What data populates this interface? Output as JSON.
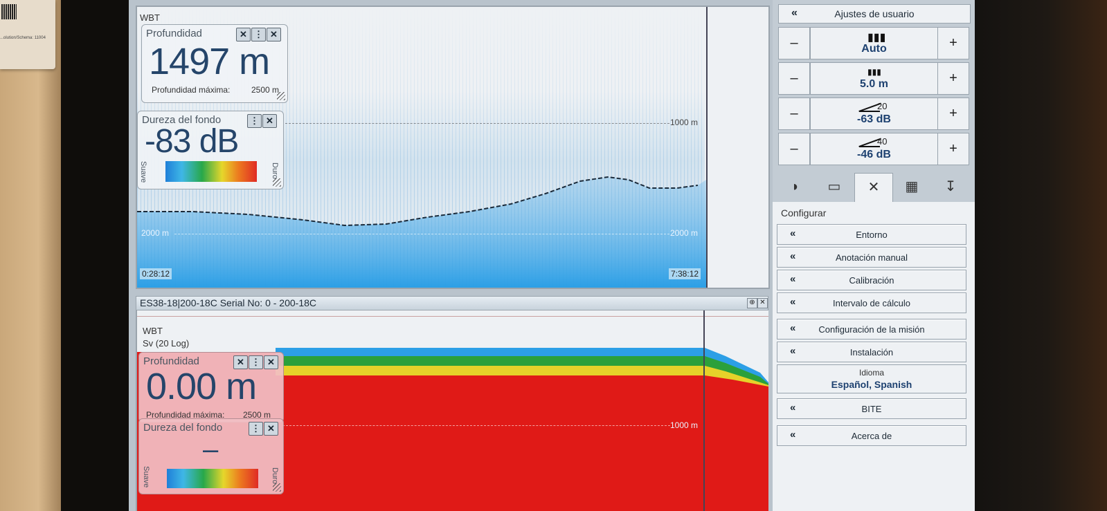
{
  "sticker": {
    "text": "...olution/Schema: 11004"
  },
  "top_echogram": {
    "tag": "WBT",
    "range_labels": [
      "1000 m",
      "2000 m",
      "1000 m",
      "2000 m"
    ],
    "time_start": "0:28:12",
    "time_end": "7:38:12",
    "colors": {
      "water": "#2c9fe6",
      "noise": "#9ccae8"
    }
  },
  "depth_widget_top": {
    "title": "Profundidad",
    "value": "1497 m",
    "max_label": "Profundidad máxima:",
    "max_value": "2500 m"
  },
  "hardness_widget_top": {
    "title": "Dureza del fondo",
    "value": "-83 dB",
    "soft_label": "Suave",
    "hard_label": "Duro"
  },
  "bottom_pane": {
    "title": "ES38-18|200-18C Serial No: 0 - 200-18C",
    "tag": "WBT",
    "subtag": "Sv (20 Log)",
    "range_label": "1000 m",
    "colors": {
      "fill": "#e01a17",
      "band_green": "#2ba03b",
      "band_blue": "#2c9fe6",
      "band_yellow": "#e6d22a"
    }
  },
  "depth_widget_bottom": {
    "title": "Profundidad",
    "value": "0.00 m",
    "max_label": "Profundidad máxima:",
    "max_value": "2500 m"
  },
  "hardness_widget_bottom": {
    "title": "Dureza del fondo",
    "value": "–",
    "soft_label": "Suave",
    "hard_label": "Duro"
  },
  "right_panel": {
    "user_settings_label": "Ajustes de usuario",
    "adjust_rows": [
      {
        "value": "Auto",
        "superscript": ""
      },
      {
        "value": "5.0 m",
        "superscript": ""
      },
      {
        "value": "-63 dB",
        "superscript": "20"
      },
      {
        "value": "-46 dB",
        "superscript": "40"
      }
    ],
    "minus_label": "–",
    "plus_label": "+",
    "configure_label": "Configurar",
    "menu_items": [
      "Entorno",
      "Anotación manual",
      "Calibración",
      "Intervalo de cálculo",
      "Configuración de la misión",
      "Instalación"
    ],
    "language": {
      "label": "Idioma",
      "value": "Español, Spanish"
    },
    "menu_items_2": [
      "BITE",
      "Acerca de"
    ]
  }
}
